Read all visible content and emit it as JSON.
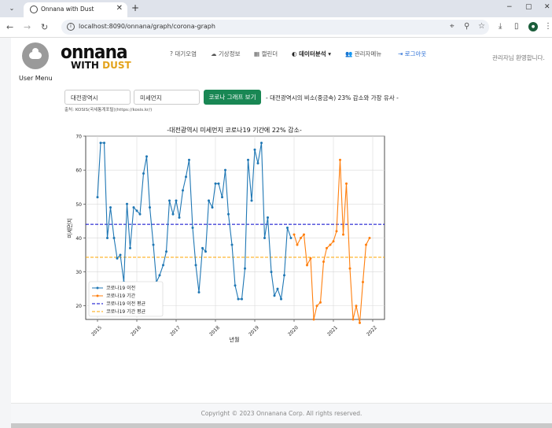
{
  "browser": {
    "tab_title": "Onnana with Dust",
    "new_tab": "+",
    "url": "localhost:8090/onnana/graph/corona-graph",
    "minimize": "−",
    "restore": "▢",
    "close": "✕"
  },
  "sidebar": {
    "user_menu": "User Menu"
  },
  "logo": {
    "line1": "onnana",
    "line2a": "WITH ",
    "line2b": "DUST"
  },
  "nav": {
    "air": "? 대기오염",
    "weather": "기상정보",
    "calendar": "캘린더",
    "analysis": "데이터분석",
    "admin": "관리자메뉴",
    "logout": "로그아웃"
  },
  "welcome": "관리자님 환영합니다.",
  "form": {
    "region": "대전광역시",
    "pollutant": "미세먼지",
    "button": "코로나 그래프 보기",
    "result": "- 대전광역시의 비소(중금속) 23% 감소와 가장 유사 -",
    "source": "출처: KOSIS(국세통계포털)(https://kosis.kr/)"
  },
  "chart_data": {
    "type": "line",
    "title": "-대전광역시 미세먼지 코로나19 기간에 22% 감소-",
    "xlabel": "년월",
    "ylabel": "미세먼지",
    "ylim": [
      16,
      70
    ],
    "xlim": [
      2014.7,
      2022.3
    ],
    "xticks": [
      "2015",
      "2016",
      "2017",
      "2018",
      "2019",
      "2020",
      "2021",
      "2022"
    ],
    "yticks": [
      20,
      30,
      40,
      50,
      60,
      70
    ],
    "grid": true,
    "legend_placement": "bottom-left",
    "series": [
      {
        "name": "코로나19 이전",
        "color": "#1f77b4",
        "x": [
          2015.0,
          2015.08,
          2015.17,
          2015.25,
          2015.33,
          2015.42,
          2015.5,
          2015.58,
          2015.67,
          2015.75,
          2015.83,
          2015.92,
          2016.0,
          2016.08,
          2016.17,
          2016.25,
          2016.33,
          2016.42,
          2016.5,
          2016.58,
          2016.67,
          2016.75,
          2016.83,
          2016.92,
          2017.0,
          2017.08,
          2017.17,
          2017.25,
          2017.33,
          2017.42,
          2017.5,
          2017.58,
          2017.67,
          2017.75,
          2017.83,
          2017.92,
          2018.0,
          2018.08,
          2018.17,
          2018.25,
          2018.33,
          2018.42,
          2018.5,
          2018.58,
          2018.67,
          2018.75,
          2018.83,
          2018.92,
          2019.0,
          2019.08,
          2019.17,
          2019.25,
          2019.33,
          2019.42,
          2019.5,
          2019.58,
          2019.67,
          2019.75,
          2019.83,
          2019.92
        ],
        "values": [
          52,
          68,
          68,
          40,
          49,
          40,
          34,
          35,
          27,
          50,
          37,
          49,
          48,
          47,
          59,
          64,
          49,
          38,
          27,
          29,
          32,
          36,
          51,
          47,
          51,
          46,
          54,
          58,
          63,
          43,
          32,
          24,
          37,
          36,
          51,
          49,
          56,
          56,
          52,
          60,
          47,
          38,
          26,
          22,
          22,
          31,
          63,
          51,
          66,
          62,
          68,
          40,
          46,
          30,
          23,
          25,
          22,
          29,
          43,
          40
        ]
      },
      {
        "name": "코로나19 기간",
        "color": "#ff7f0e",
        "x": [
          2020.0,
          2020.08,
          2020.17,
          2020.25,
          2020.33,
          2020.42,
          2020.5,
          2020.58,
          2020.67,
          2020.75,
          2020.83,
          2020.92,
          2021.0,
          2021.08,
          2021.17,
          2021.25,
          2021.33,
          2021.42,
          2021.5,
          2021.58,
          2021.67,
          2021.75,
          2021.83,
          2021.92
        ],
        "values": [
          41,
          38,
          40,
          41,
          32,
          34,
          16,
          20,
          21,
          33,
          37,
          38,
          39,
          42,
          63,
          41,
          56,
          31,
          16,
          20,
          15,
          27,
          38,
          40
        ]
      }
    ],
    "reference_lines": [
      {
        "name": "코로나19 이전 평균",
        "value": 44,
        "color": "#0000cc",
        "style": "dashed"
      },
      {
        "name": "코로나19 기간 평균",
        "value": 34.3,
        "color": "#ffa500",
        "style": "dashed"
      }
    ]
  },
  "footer": "Copyright © 2023 Onnanana Corp. All rights reserved."
}
